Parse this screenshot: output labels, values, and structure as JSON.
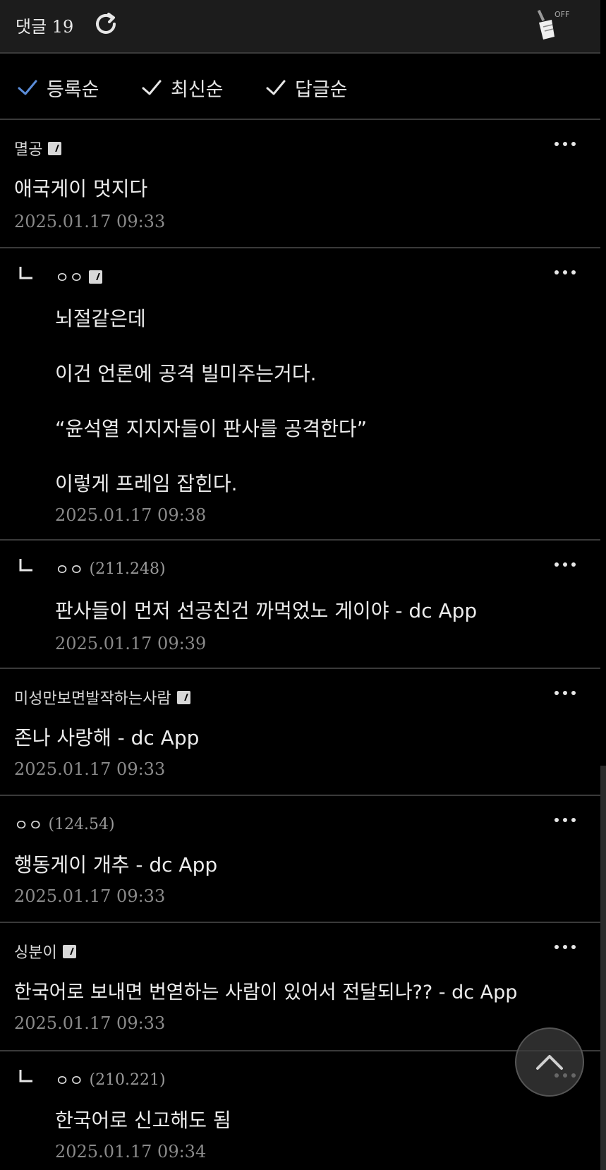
{
  "header": {
    "title": "댓글 19",
    "refresh_icon": "refresh-icon",
    "clean_icon": "broom-icon",
    "clean_badge": "OFF"
  },
  "sort": {
    "options": [
      {
        "label": "등록순",
        "active": true
      },
      {
        "label": "최신순",
        "active": false
      },
      {
        "label": "답글순",
        "active": false
      }
    ],
    "active_color": "#5b8dd9",
    "inactive_color": "#e6e6e6"
  },
  "comments": [
    {
      "author": "멸공",
      "ip": "",
      "badge": true,
      "reply": false,
      "lines": [
        "애국게이 멋지다"
      ],
      "date": "2025.01.17 09:33"
    },
    {
      "author": "ㅇㅇ",
      "ip": "",
      "badge": true,
      "reply": true,
      "lines": [
        "뇌절같은데",
        "이건 언론에 공격 빌미주는거다.",
        "“윤석열 지지자들이 판사를 공격한다”",
        "이렇게 프레임 잡힌다."
      ],
      "date": "2025.01.17 09:38"
    },
    {
      "author": "ㅇㅇ",
      "ip": "(211.248)",
      "badge": false,
      "reply": true,
      "lines": [
        "판사들이 먼저 선공친건 까먹었노 게이야 - dc App"
      ],
      "date": "2025.01.17 09:39"
    },
    {
      "author": "미성만보면발작하는사람",
      "ip": "",
      "badge": true,
      "reply": false,
      "lines": [
        "존나 사랑해 - dc App"
      ],
      "date": "2025.01.17 09:33"
    },
    {
      "author": "ㅇㅇ",
      "ip": "(124.54)",
      "badge": false,
      "reply": false,
      "lines": [
        "행동게이 개추 - dc App"
      ],
      "date": "2025.01.17 09:33"
    },
    {
      "author": "싱분이",
      "ip": "",
      "badge": true,
      "reply": false,
      "lines": [
        "한국어로 보내면 번엳하는 사람이 있어서 전달되나?? - dc App"
      ],
      "date": "2025.01.17 09:33"
    },
    {
      "author": "ㅇㅇ",
      "ip": "(210.221)",
      "badge": false,
      "reply": true,
      "lines": [
        "한국어로 신고해도 됨"
      ],
      "date": "2025.01.17 09:34"
    }
  ]
}
